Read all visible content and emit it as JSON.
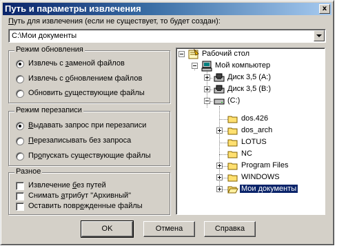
{
  "window": {
    "title": "Путь и параметры извлечения",
    "close_label": "x"
  },
  "path": {
    "label_prefix": "",
    "label_accel": "П",
    "label_rest": "уть для извлечения (если не существует, то будет создан):",
    "value": "C:\\Мои документы"
  },
  "update_mode": {
    "legend": "Режим обновления",
    "options": [
      {
        "pre": "Извлечь с ",
        "acc": "з",
        "post": "аменой файлов",
        "selected": true
      },
      {
        "pre": "Извлечь с ",
        "acc": "о",
        "post": "бновлением файлов",
        "selected": false
      },
      {
        "pre": "Обновить ",
        "acc": "с",
        "post": "уществующие файлы",
        "selected": false
      }
    ]
  },
  "overwrite_mode": {
    "legend": "Режим перезаписи",
    "options": [
      {
        "pre": "",
        "acc": "В",
        "post": "ыдавать запрос при перезаписи",
        "selected": true
      },
      {
        "pre": "",
        "acc": "П",
        "post": "ерезаписывать без запроса",
        "selected": false
      },
      {
        "pre": "Пр",
        "acc": "о",
        "post": "пускать существующие файлы",
        "selected": false
      }
    ]
  },
  "misc": {
    "legend": "Разное",
    "options": [
      {
        "pre": "Извлечение ",
        "acc": "б",
        "post": "ез путей",
        "checked": false
      },
      {
        "pre": "Снимать ",
        "acc": "а",
        "post": "трибут \"Архивный\"",
        "checked": false
      },
      {
        "pre": "Оставить повр",
        "acc": "е",
        "post": "жденные файлы",
        "checked": false
      }
    ]
  },
  "tree": {
    "desktop": "Рабочий стол",
    "my_computer": "Мой компьютер",
    "floppy_a": "Диск 3,5 (A:)",
    "floppy_b": "Диск 3,5 (B:)",
    "drive_c": "(C:)",
    "folders": [
      "dos.426",
      "dos_arch",
      "LOTUS",
      "NC",
      "Program Files",
      "WINDOWS",
      "Мои документы"
    ]
  },
  "buttons": {
    "ok": "OK",
    "cancel": "Отмена",
    "help": "Справка"
  }
}
